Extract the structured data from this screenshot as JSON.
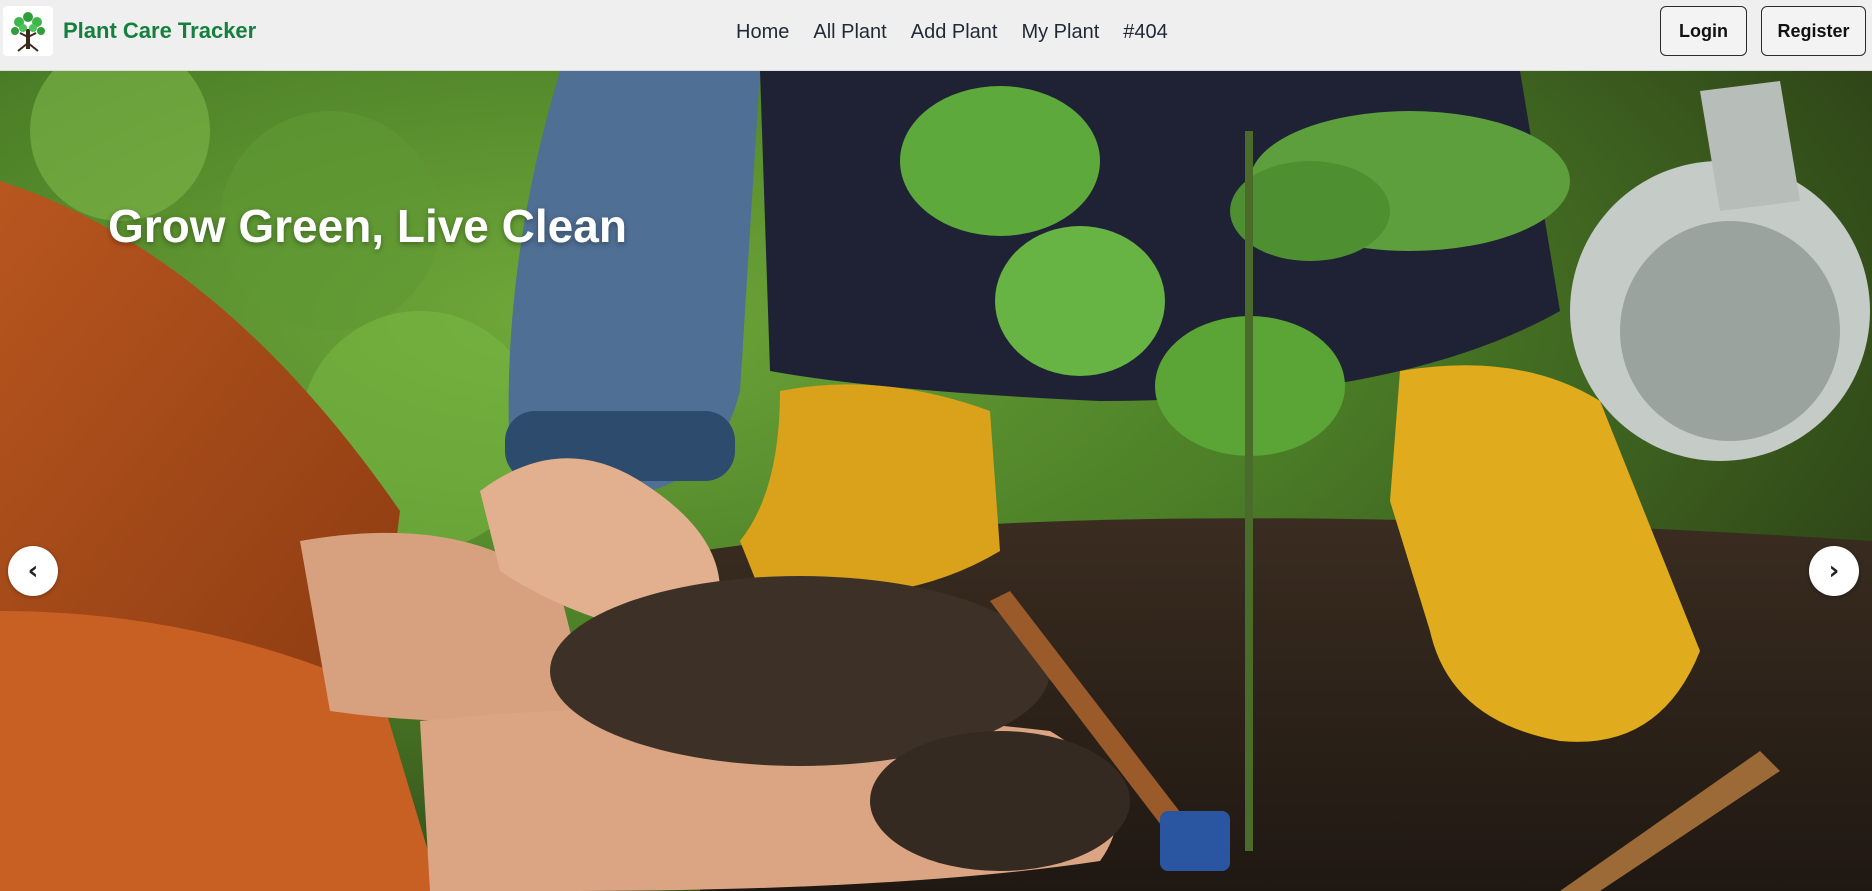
{
  "navbar": {
    "brand_name": "Plant Care Tracker",
    "logo_icon": "tree-icon",
    "links": [
      {
        "label": "Home"
      },
      {
        "label": "All Plant"
      },
      {
        "label": "Add Plant"
      },
      {
        "label": "My Plant"
      },
      {
        "label": "#404"
      }
    ],
    "login_label": "Login",
    "register_label": "Register"
  },
  "hero": {
    "title": "Grow Green, Live Clean",
    "prev_icon": "chevron-left-icon",
    "next_icon": "chevron-right-icon",
    "prev_glyph": "‹",
    "next_glyph": "›"
  },
  "colors": {
    "brand": "#15803d",
    "navbar_bg": "#efefef"
  }
}
